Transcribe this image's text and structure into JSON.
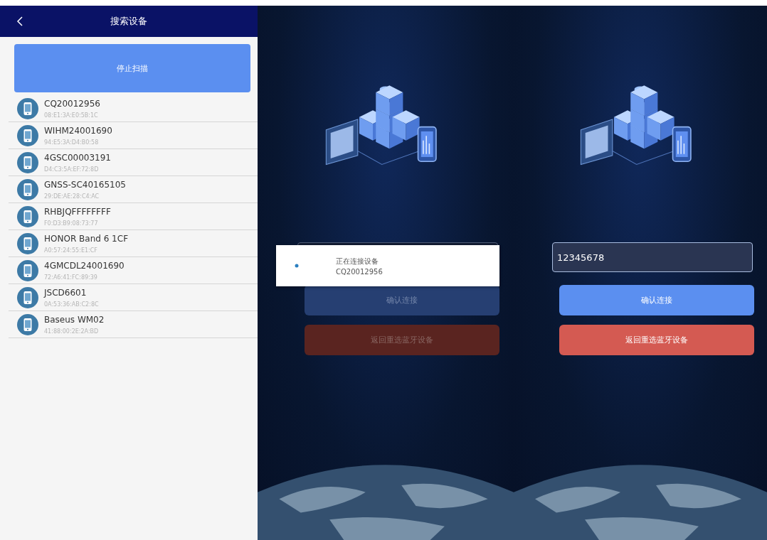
{
  "device_list_screen": {
    "title": "搜索设备",
    "scan_button": "停止扫描",
    "devices": [
      {
        "name": "CQ20012956",
        "address": "08:E1:3A:E0:5B:1C"
      },
      {
        "name": "WIHM24001690",
        "address": "94:E5:3A:D4:B0:58"
      },
      {
        "name": "4GSC00003191",
        "address": "D4:C3:5A:EF:72:8D"
      },
      {
        "name": "GNSS-SC40165105",
        "address": "29:DE:AE:28:C4:AC"
      },
      {
        "name": "RHBJQFFFFFFFF",
        "address": "F0:D3:B9:08:73:77"
      },
      {
        "name": "HONOR Band 6 1CF",
        "address": "A0:57:24:55:E1:CF"
      },
      {
        "name": "4GMCDL24001690",
        "address": "72:A6:41:FC:89:39"
      },
      {
        "name": "JSCD6601",
        "address": "0A:53:36:AB:C2:8C"
      },
      {
        "name": "Baseus WM02",
        "address": "41:88:00:2E:2A:BD"
      }
    ]
  },
  "connecting_screen": {
    "dimmed": true,
    "confirm_button": "确认连接",
    "back_button": "返回重选蓝牙设备",
    "dialog": {
      "message": "正在连接设备",
      "device": "CQ20012956"
    }
  },
  "password_screen": {
    "dimmed": false,
    "password_field": {
      "value": "12345678"
    },
    "confirm_button": "确认连接",
    "back_button": "返回重选蓝牙设备"
  }
}
